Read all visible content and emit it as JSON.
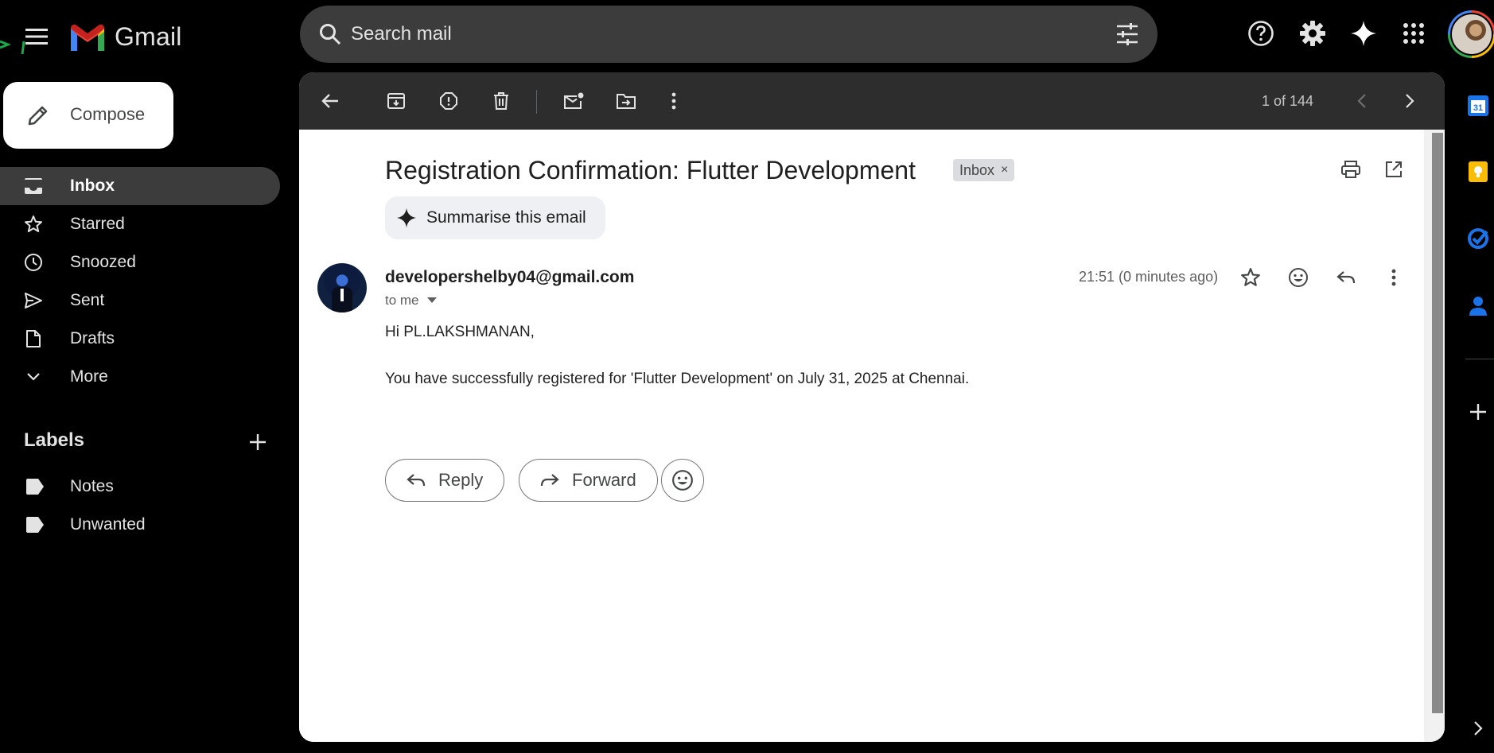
{
  "app": {
    "name": "Gmail"
  },
  "search": {
    "placeholder": "Search mail"
  },
  "sidebar": {
    "compose_label": "Compose",
    "items": [
      {
        "label": "Inbox",
        "icon": "inbox-icon",
        "active": true
      },
      {
        "label": "Starred",
        "icon": "star-icon"
      },
      {
        "label": "Snoozed",
        "icon": "clock-icon"
      },
      {
        "label": "Sent",
        "icon": "send-icon"
      },
      {
        "label": "Drafts",
        "icon": "draft-icon"
      },
      {
        "label": "More",
        "icon": "chevron-down-icon"
      }
    ],
    "labels_heading": "Labels",
    "labels": [
      {
        "label": "Notes"
      },
      {
        "label": "Unwanted"
      }
    ]
  },
  "toolbar": {
    "pager": "1 of 144"
  },
  "email": {
    "subject": "Registration Confirmation: Flutter Development",
    "chip": "Inbox",
    "chip_close": "×",
    "summarise": "Summarise this email",
    "sender": "developershelby04@gmail.com",
    "to": "to me",
    "time": "21:51 (0 minutes ago)",
    "greeting": "Hi PL.LAKSHMANAN,",
    "body": "You have successfully registered for 'Flutter Development' on July 31, 2025 at Chennai.",
    "reply_label": "Reply",
    "forward_label": "Forward"
  },
  "colors": {
    "background": "#000000",
    "panel": "#ffffff",
    "search_bg": "#3c3c3c",
    "active_nav": "#3c3c3c",
    "calendar_blue": "#1a73e8",
    "keep_yellow": "#fbbc04"
  }
}
